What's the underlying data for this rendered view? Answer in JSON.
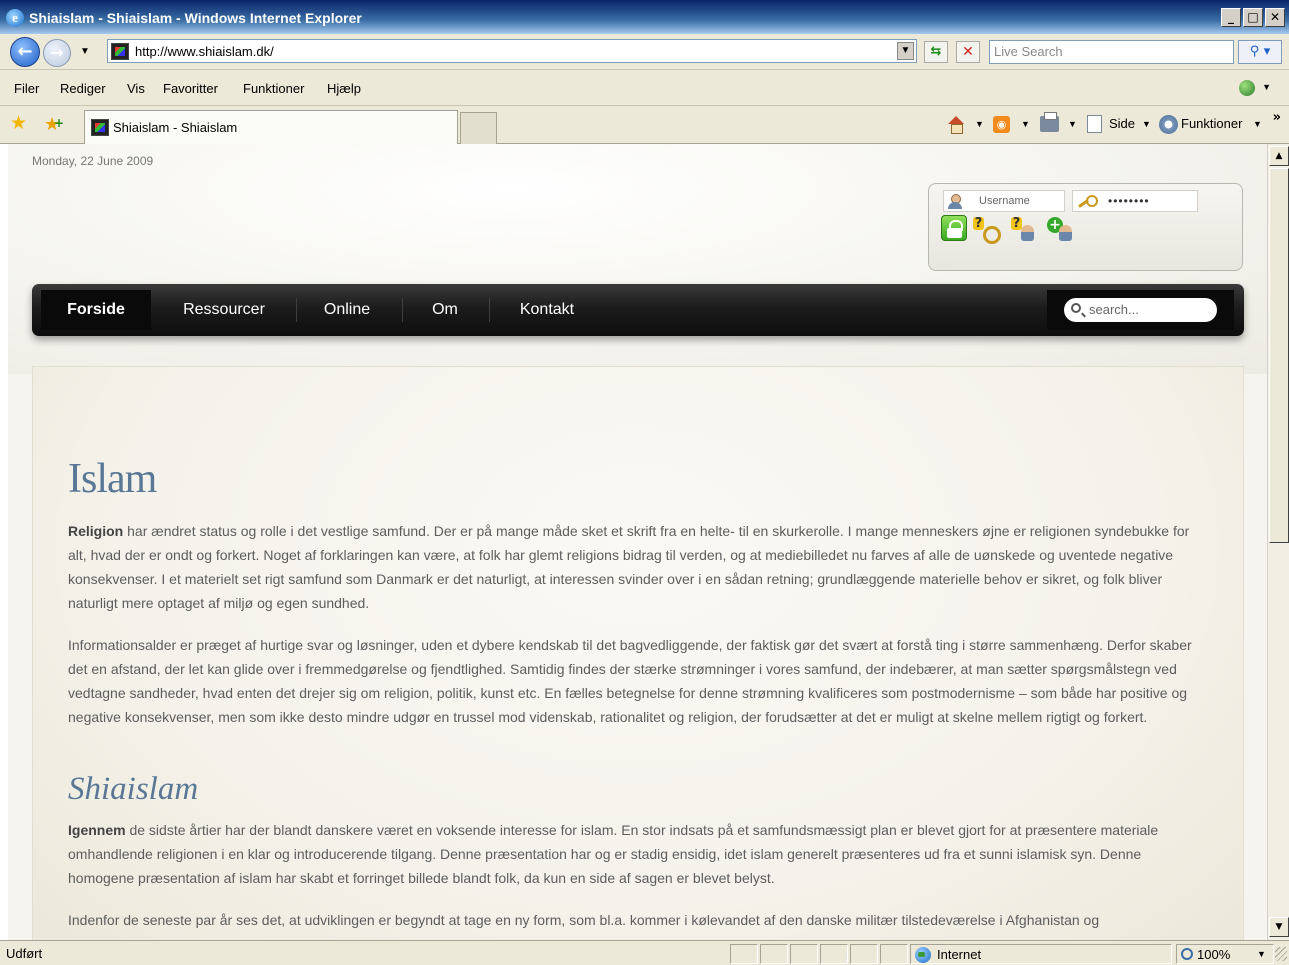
{
  "window": {
    "title": "Shiaislam - Shiaislam - Windows Internet Explorer",
    "controls": [
      "_",
      "□",
      "✕"
    ]
  },
  "address_bar": {
    "url": "http://www.shiaislam.dk/",
    "search_placeholder": "Live Search"
  },
  "menu": {
    "items": [
      "Filer",
      "Rediger",
      "Vis",
      "Favoritter",
      "Funktioner",
      "Hjælp"
    ]
  },
  "tabs": {
    "active_label": "Shiaislam - Shiaislam"
  },
  "command_bar": {
    "page_label": "Side",
    "tools_label": "Funktioner"
  },
  "page": {
    "date": "Monday, 22 June 2009",
    "login": {
      "username_placeholder": "Username",
      "password_masked": "••••••••"
    },
    "nav": {
      "items": [
        "Forside",
        "Ressourcer",
        "Online",
        "Om",
        "Kontakt"
      ],
      "active": "Forside",
      "search_placeholder": "search..."
    },
    "article": {
      "heading1": "Islam",
      "p1_lead": "Religion",
      "p1_rest": " har ændret status og rolle i det vestlige samfund. Der er på mange måde sket et skrift fra en helte- til en skurkerolle. I mange menneskers øjne er religionen syndebukke for alt, hvad der er ondt og forkert. Noget af forklaringen kan være, at folk har glemt religions bidrag til verden, og at mediebilledet nu farves af alle de uønskede og uventede negative konsekvenser. I et materielt set rigt samfund som Danmark er det naturligt, at interessen svinder over i en sådan retning; grundlæggende materielle behov er sikret, og folk bliver naturligt mere optaget af miljø og egen sundhed.",
      "p2": "Informationsalder er præget af hurtige svar og løsninger, uden et dybere kendskab til det bagvedliggende, der faktisk gør det svært at forstå ting i større sammenhæng. Derfor skaber det en afstand, der let kan glide over i fremmedgørelse og fjendtlighed. Samtidig findes der stærke strømninger i vores samfund, der indebærer, at man sætter spørgsmålstegn ved vedtagne sandheder, hvad enten det drejer sig om religion, politik, kunst etc. En fælles betegnelse for denne strømning kvalificeres som postmodernisme – som både har positive og negative konsekvenser, men som ikke desto mindre udgør en trussel mod videnskab, rationalitet og religion, der forudsætter at det er muligt at skelne mellem rigtigt og forkert.",
      "heading2": "Shiaislam",
      "p3_lead": "Igennem",
      "p3_rest": " de sidste årtier har der blandt danskere været en voksende interesse for islam. En stor indsats på et samfundsmæssigt plan er blevet gjort for at præsentere materiale omhandlende religionen i en klar og introducerende tilgang. Denne præsentation har og er stadig ensidig, idet islam generelt præsenteres ud fra et sunni islamisk syn. Denne homogene præsentation af islam har skabt et forringet billede blandt folk, da kun en side af sagen er blevet belyst.",
      "p4": "Indenfor de seneste par år ses det, at udviklingen er begyndt at tage en ny form, som bl.a. kommer i kølevandet af den danske militær tilstedeværelse i Afghanistan og"
    }
  },
  "status_bar": {
    "status": "Udført",
    "zone": "Internet",
    "zoom": "100%"
  }
}
